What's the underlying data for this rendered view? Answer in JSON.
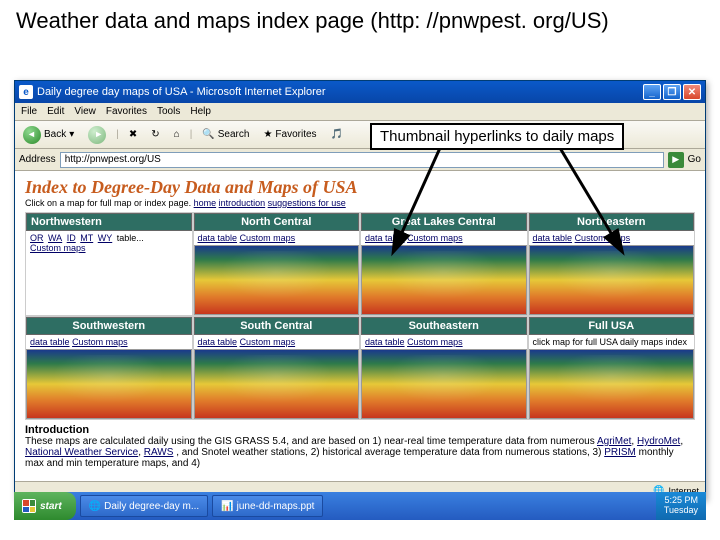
{
  "slide_title": "Weather data and maps index page (http: //pnwpest. org/US)",
  "callout": "Thumbnail hyperlinks to daily maps",
  "titlebar": {
    "text": "Daily degree day maps of USA - Microsoft Internet Explorer"
  },
  "winbtns": {
    "min": "_",
    "max": "❐",
    "close": "✕"
  },
  "menubar": [
    "File",
    "Edit",
    "View",
    "Favorites",
    "Tools",
    "Help"
  ],
  "toolbar": {
    "back": "Back",
    "search": "Search",
    "favorites": "Favorites"
  },
  "addrbar": {
    "label": "Address",
    "value": "http://pnwpest.org/US",
    "go": "Go"
  },
  "page": {
    "title": "Index to Degree-Day Data and Maps of USA",
    "subtitle_prefix": "Click on a map for full map or index page. ",
    "sub_links": [
      "home",
      "introduction",
      "suggestions for use"
    ],
    "regions": [
      {
        "hdr": "Northwestern",
        "links_nw": [
          "OR",
          "WA",
          "ID",
          "MT",
          "WY"
        ],
        "links_tail": "table...",
        "cm": "Custom maps"
      },
      {
        "hdr": "North Central",
        "dt": "data table",
        "cm": "Custom maps"
      },
      {
        "hdr": "Great Lakes Central",
        "dt": "data table",
        "cm": "Custom maps"
      },
      {
        "hdr": "Northeastern",
        "dt": "data table",
        "cm": "Custom maps"
      },
      {
        "hdr": "Southwestern",
        "dt": "data table",
        "cm": "Custom maps"
      },
      {
        "hdr": "South Central",
        "dt": "data table",
        "cm": "Custom maps"
      },
      {
        "hdr": "Southeastern",
        "dt": "data table",
        "cm": "Custom maps"
      },
      {
        "hdr": "Full USA",
        "full_text": "click map for full USA daily maps index"
      }
    ],
    "intro_hdr": "Introduction",
    "intro_body_1": "These maps are calculated daily using the GIS GRASS 5.4, and are based on 1) near-real time temperature data from numerous ",
    "intro_links": [
      "AgriMet",
      "HydroMet",
      "National Weather Service",
      "RAWS"
    ],
    "intro_body_2": ", and Snotel weather stations, 2) historical average temperature data from numerous stations, 3) ",
    "intro_link_prism": "PRISM",
    "intro_body_3": " monthly max and min temperature maps, and 4)"
  },
  "statusbar": {
    "internet": "Internet"
  },
  "taskbar": {
    "start": "start",
    "btn1": "Daily degree-day m...",
    "btn2": "june-dd-maps.ppt",
    "clock_time": "5:25 PM",
    "clock_day": "Tuesday"
  }
}
